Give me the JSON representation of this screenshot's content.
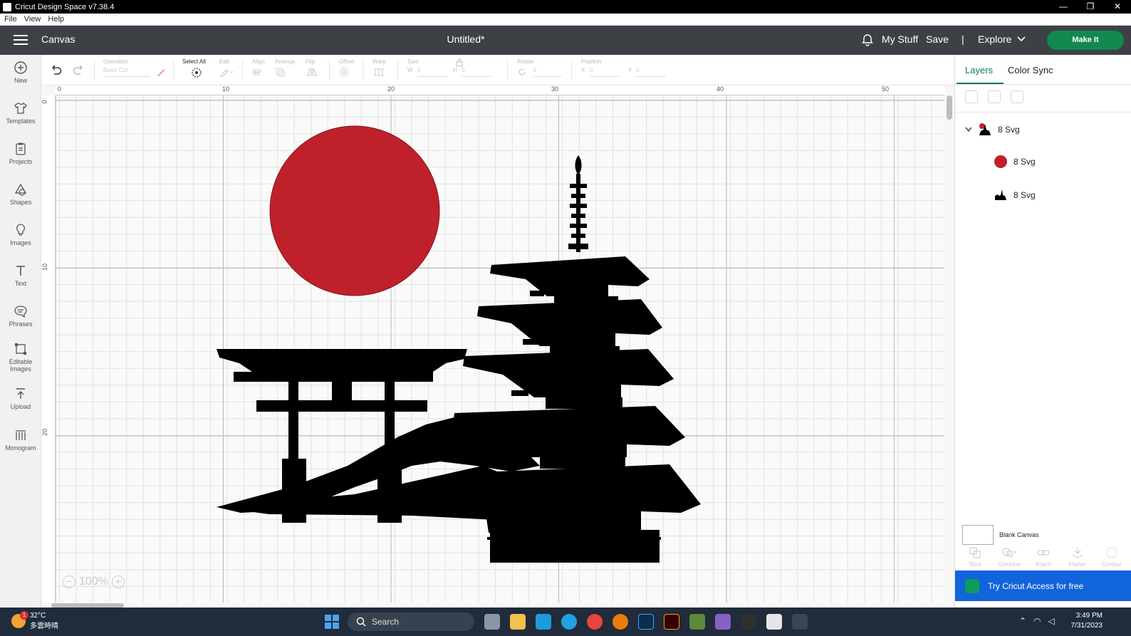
{
  "window": {
    "title": "Cricut Design Space  v7.38.4",
    "controls": [
      "—",
      "❐",
      "✕"
    ]
  },
  "menubar": {
    "items": [
      "File",
      "View",
      "Help"
    ]
  },
  "header": {
    "section": "Canvas",
    "document_title": "Untitled*",
    "my_stuff": "My Stuff",
    "save": "Save",
    "separator": "|",
    "explore": "Explore",
    "make_it": "Make It"
  },
  "sidebar": {
    "items": [
      {
        "label": "New",
        "icon": "plus-circle-icon"
      },
      {
        "label": "Templates",
        "icon": "shirt-icon"
      },
      {
        "label": "Projects",
        "icon": "clipboard-icon"
      },
      {
        "label": "Shapes",
        "icon": "shapes-icon"
      },
      {
        "label": "Images",
        "icon": "lightbulb-icon"
      },
      {
        "label": "Text",
        "icon": "text-icon"
      },
      {
        "label": "Phrases",
        "icon": "speech-bubble-icon"
      },
      {
        "label": "Editable Images",
        "icon": "editable-image-icon"
      },
      {
        "label": "Upload",
        "icon": "upload-icon"
      },
      {
        "label": "Monogram",
        "icon": "monogram-icon"
      }
    ]
  },
  "toolbar": {
    "operation_label": "Operation",
    "operation_value": "Basic Cut",
    "select_all": "Select All",
    "edit": "Edit",
    "align": "Align",
    "arrange": "Arrange",
    "flip": "Flip",
    "offset": "Offset",
    "warp": "Warp",
    "size": "Size",
    "size_w_label": "W",
    "size_w": "0",
    "size_h_label": "H",
    "size_h": "0",
    "rotate": "Rotate",
    "rotate_value": "0",
    "position": "Position",
    "pos_x_label": "X",
    "pos_x": "0",
    "pos_y_label": "Y",
    "pos_y": "0"
  },
  "rulers": {
    "top": [
      "0",
      "10",
      "20",
      "30",
      "40",
      "50"
    ],
    "left": [
      "0",
      "10",
      "20"
    ]
  },
  "canvas": {
    "zoom": "100%",
    "sun_color": "#c0202a",
    "silhouette_color": "#000000"
  },
  "panel": {
    "tabs": [
      "Layers",
      "Color Sync"
    ],
    "layers": [
      {
        "name": "8 Svg",
        "level": 0,
        "icon": "group-thumbnail-icon"
      },
      {
        "name": "8 Svg",
        "level": 1,
        "icon": "red-circle-thumbnail-icon"
      },
      {
        "name": "8 Svg",
        "level": 1,
        "icon": "silhouette-thumbnail-icon"
      }
    ],
    "blank_canvas": "Blank Canvas",
    "tools": [
      "Slice",
      "Combine",
      "Attach",
      "Flatten",
      "Contour"
    ],
    "access_banner": "Try Cricut Access for free"
  },
  "taskbar": {
    "weather_temp": "32°C",
    "weather_desc": "多雲時晴",
    "weather_badge": "1",
    "search_placeholder": "Search",
    "time": "3:49 PM",
    "date": "7/31/2023"
  }
}
